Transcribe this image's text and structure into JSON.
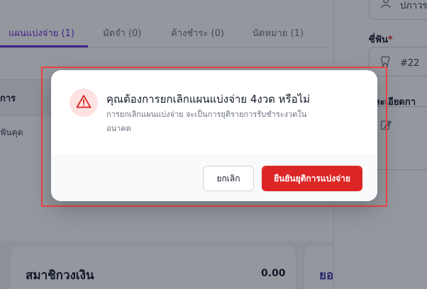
{
  "tabs": [
    {
      "label": "แผนแบ่งจ่าย (1)",
      "active": true
    },
    {
      "label": "มัดจำ (0)",
      "active": false
    },
    {
      "label": "ค้างชำระ (0)",
      "active": false
    },
    {
      "label": "นัดหมาย (1)",
      "active": false
    }
  ],
  "table": {
    "header_fragment": "การ",
    "row_fragment": "ฟันคุด"
  },
  "cards": {
    "wallet_title": "สมาชิกวงเงิน",
    "wallet_value": "0.00",
    "second_title_fragment": "ยอ"
  },
  "drawer": {
    "top_field_value": "ปภาวร",
    "tooth_label": "ซี่ฟัน",
    "tooth_required_mark": "*",
    "tooth_value": "#22",
    "details_label_fragment": "ยละเอียดกา"
  },
  "modal": {
    "title": "คุณต้องการยกเลิกแผนแบ่งจ่าย 4งวด หรือไม่",
    "description": "การยกเลิกแผนแบ่งจ่าย จะเป็นการยุติรายการรับชำระงวดใน อนาคต",
    "cancel_label": "ยกเลิก",
    "confirm_label": "ยืนยันยุติการแบ่งจ่าย",
    "icon": "warning-triangle-icon"
  },
  "colors": {
    "accent": "#6d28d9",
    "danger": "#dc2626",
    "highlight": "#ef4444"
  }
}
